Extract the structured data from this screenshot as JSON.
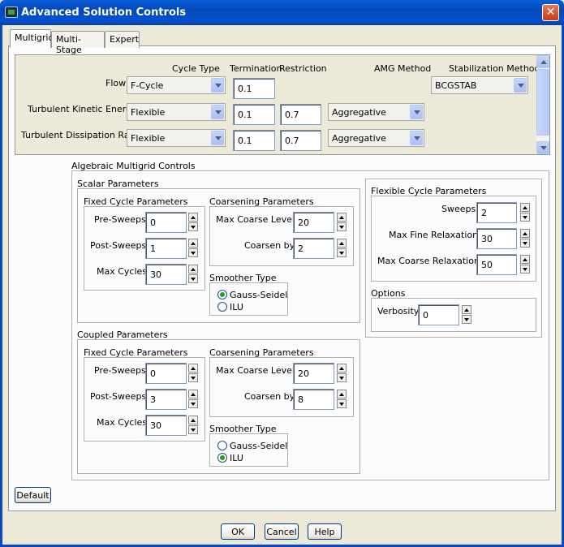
{
  "window": {
    "title": "Advanced Solution Controls",
    "close_glyph": "✕"
  },
  "tabs": [
    {
      "label": "Multigrid"
    },
    {
      "label": "Multi-Stage"
    },
    {
      "label": "Expert"
    }
  ],
  "top_table": {
    "headers": {
      "cycle_type": "Cycle Type",
      "termination": "Termination",
      "restriction": "Restriction",
      "amg_method": "AMG Method",
      "stabilization": "Stabilization Method"
    },
    "rows": [
      {
        "label": "Flow",
        "cycle_type": "F-Cycle",
        "termination": "0.1",
        "stabilization": "BCGSTAB"
      },
      {
        "label": "Turbulent Kinetic Energy",
        "cycle_type": "Flexible",
        "termination": "0.1",
        "restriction": "0.7",
        "amg_method": "Aggregative"
      },
      {
        "label": "Turbulent Dissipation Rate",
        "cycle_type": "Flexible",
        "termination": "0.1",
        "restriction": "0.7",
        "amg_method": "Aggregative"
      }
    ]
  },
  "amg": {
    "title": "Algebraic Multigrid Controls",
    "scalar": {
      "title": "Scalar Parameters",
      "fixed": {
        "title": "Fixed Cycle Parameters",
        "pre_label": "Pre-Sweeps",
        "pre": "0",
        "post_label": "Post-Sweeps",
        "post": "1",
        "max_label": "Max Cycles",
        "max": "30"
      },
      "coarsening": {
        "title": "Coarsening Parameters",
        "levels_label": "Max Coarse Levels",
        "levels": "20",
        "by_label": "Coarsen by",
        "by": "2"
      },
      "smoother": {
        "title": "Smoother Type",
        "opt1": "Gauss-Seidel",
        "opt2": "ILU",
        "selected": "Gauss-Seidel"
      }
    },
    "coupled": {
      "title": "Coupled Parameters",
      "fixed": {
        "title": "Fixed Cycle Parameters",
        "pre_label": "Pre-Sweeps",
        "pre": "0",
        "post_label": "Post-Sweeps",
        "post": "3",
        "max_label": "Max Cycles",
        "max": "30"
      },
      "coarsening": {
        "title": "Coarsening Parameters",
        "levels_label": "Max Coarse Levels",
        "levels": "20",
        "by_label": "Coarsen by",
        "by": "8"
      },
      "smoother": {
        "title": "Smoother Type",
        "opt1": "Gauss-Seidel",
        "opt2": "ILU",
        "selected": "ILU"
      }
    },
    "flexible": {
      "title": "Flexible Cycle Parameters",
      "sweeps_label": "Sweeps",
      "sweeps": "2",
      "fine_label": "Max Fine Relaxations",
      "fine": "30",
      "coarse_label": "Max Coarse Relaxations",
      "coarse": "50"
    },
    "options": {
      "title": "Options",
      "verbosity_label": "Verbosity",
      "verbosity": "0"
    }
  },
  "buttons": {
    "default": "Default",
    "ok": "OK",
    "cancel": "Cancel",
    "help": "Help"
  },
  "colors": {
    "titlebar": "#0348b8",
    "radio_dot": "#21a121"
  }
}
